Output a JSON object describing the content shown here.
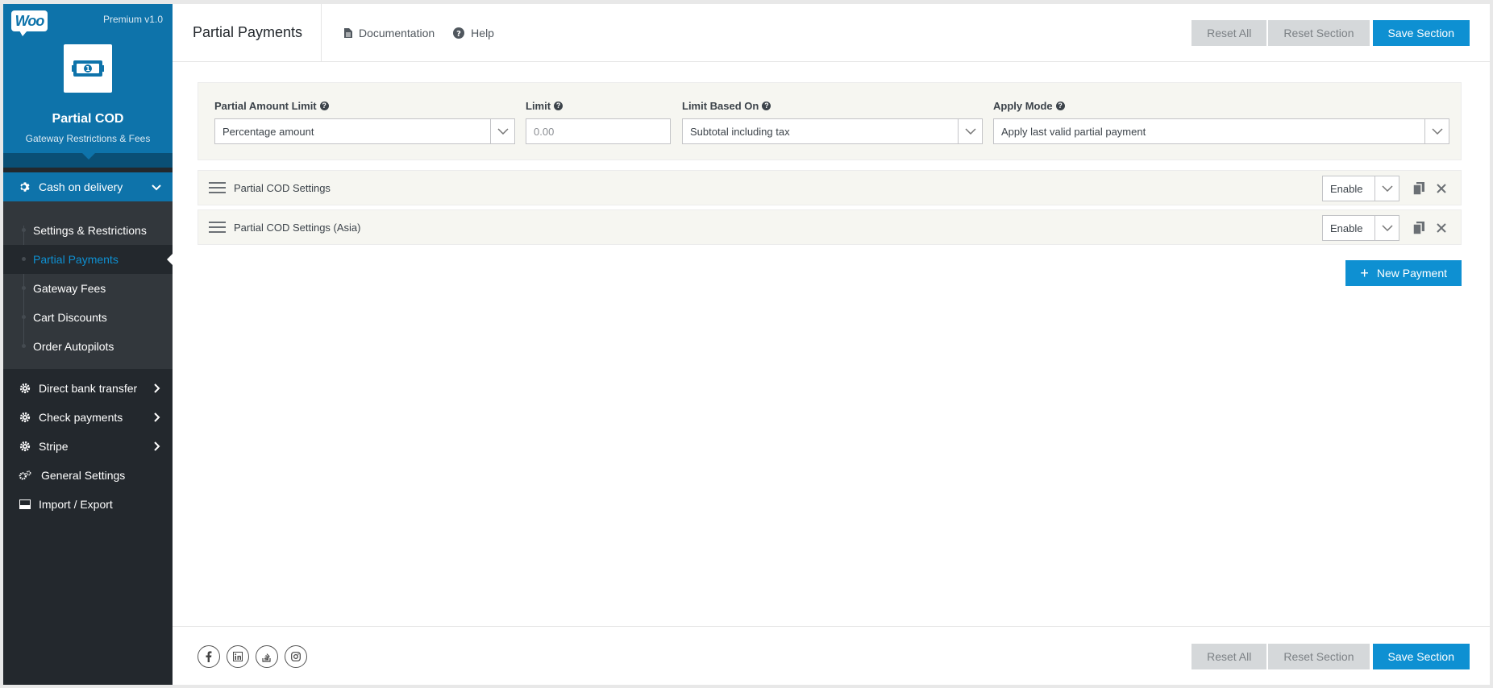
{
  "brand": {
    "logo_text": "Woo",
    "version": "Premium v1.0",
    "plugin_name": "Partial COD",
    "plugin_subtitle": "Gateway Restrictions & Fees"
  },
  "sidebar": {
    "active_group": "Cash on delivery",
    "submenu": [
      {
        "label": "Settings & Restrictions",
        "current": false
      },
      {
        "label": "Partial Payments",
        "current": true
      },
      {
        "label": "Gateway Fees",
        "current": false
      },
      {
        "label": "Cart Discounts",
        "current": false
      },
      {
        "label": "Order Autopilots",
        "current": false
      }
    ],
    "groups": [
      {
        "label": "Direct bank transfer"
      },
      {
        "label": "Check payments"
      },
      {
        "label": "Stripe"
      }
    ],
    "general_settings": "General Settings",
    "import_export": "Import / Export"
  },
  "header": {
    "title": "Partial Payments",
    "documentation": "Documentation",
    "help": "Help",
    "reset_all": "Reset All",
    "reset_section": "Reset Section",
    "save_section": "Save Section"
  },
  "filters": {
    "partial_amount_limit": {
      "label": "Partial Amount Limit",
      "value": "Percentage amount"
    },
    "limit": {
      "label": "Limit",
      "placeholder": "0.00"
    },
    "limit_based_on": {
      "label": "Limit Based On",
      "value": "Subtotal including tax"
    },
    "apply_mode": {
      "label": "Apply Mode",
      "value": "Apply last valid partial payment"
    }
  },
  "payments": [
    {
      "title": "Partial COD Settings",
      "status": "Enable"
    },
    {
      "title": "Partial COD Settings (Asia)",
      "status": "Enable"
    }
  ],
  "new_payment": "New Payment",
  "footer": {
    "reset_all": "Reset All",
    "reset_section": "Reset Section",
    "save_section": "Save Section"
  },
  "colors": {
    "accent": "#0e90d2",
    "brand": "#0e73aa",
    "sidebar": "#23282d"
  }
}
